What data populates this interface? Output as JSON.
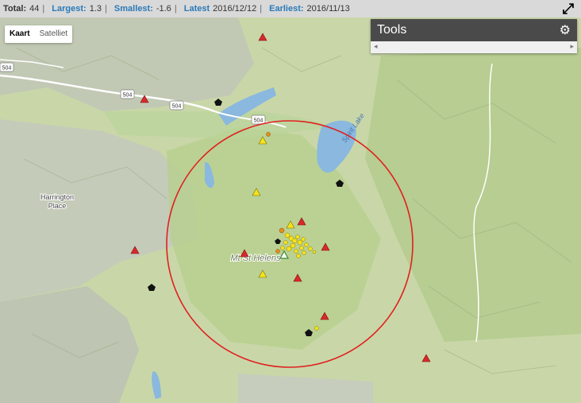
{
  "stats": {
    "total_label": "Total:",
    "total_value": "44",
    "largest_label": "Largest:",
    "largest_value": "1.3",
    "smallest_label": "Smallest:",
    "smallest_value": "-1.6",
    "latest_label": "Latest",
    "latest_value": "2016/12/12",
    "earliest_label": "Earliest:",
    "earliest_value": "2016/11/13"
  },
  "map_type": {
    "map_label": "Kaart",
    "satellite_label": "Satelliet"
  },
  "tools": {
    "title": "Tools"
  },
  "map_labels": {
    "place": [
      "Harrington",
      "Place"
    ],
    "volcano": "Mt St Helens",
    "lake": "Spirit Lake",
    "routes": [
      "504",
      "504",
      "504",
      "504"
    ]
  },
  "colors": {
    "circle": "#e02020",
    "triangle_red": "#d9292b",
    "quake_yellow": "#f5e31a",
    "quake_orange": "#e88c1c",
    "water": "#8ab8de",
    "accent": "#2a7ab8"
  },
  "icons": {
    "expand": "expand-icon",
    "gear": "gear-icon"
  }
}
